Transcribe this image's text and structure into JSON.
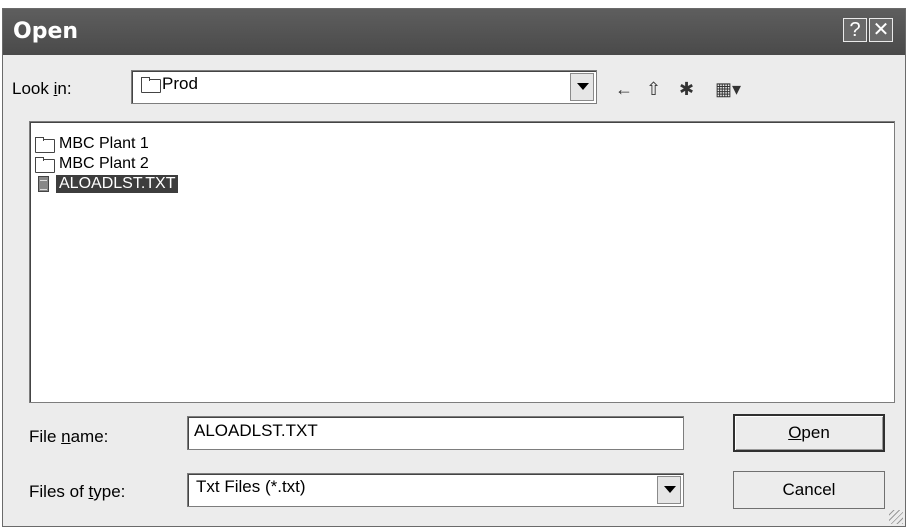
{
  "window": {
    "title": "Open",
    "help_glyph": "?",
    "close_glyph": "✕"
  },
  "look_in": {
    "label_prefix": "Look ",
    "label_underlined": "i",
    "label_suffix": "n:",
    "value": "Prod"
  },
  "toolbar": {
    "back_icon": "←",
    "up_folder_icon": "⇧",
    "new_folder_icon": "✱",
    "view_menu_icon": "▦▾"
  },
  "files": [
    {
      "name": "MBC Plant 1",
      "type": "folder",
      "selected": false
    },
    {
      "name": "MBC Plant 2",
      "type": "folder",
      "selected": false
    },
    {
      "name": "ALOADLST.TXT",
      "type": "file",
      "selected": true
    }
  ],
  "file_name": {
    "label_prefix": "File ",
    "label_underlined": "n",
    "label_suffix": "ame:",
    "value": "ALOADLST.TXT"
  },
  "file_type": {
    "label_prefix": "Files of ",
    "label_underlined": "t",
    "label_suffix": "ype:",
    "value": "Txt Files (*.txt)"
  },
  "buttons": {
    "open_underlined": "O",
    "open_rest": "pen",
    "cancel": "Cancel"
  }
}
